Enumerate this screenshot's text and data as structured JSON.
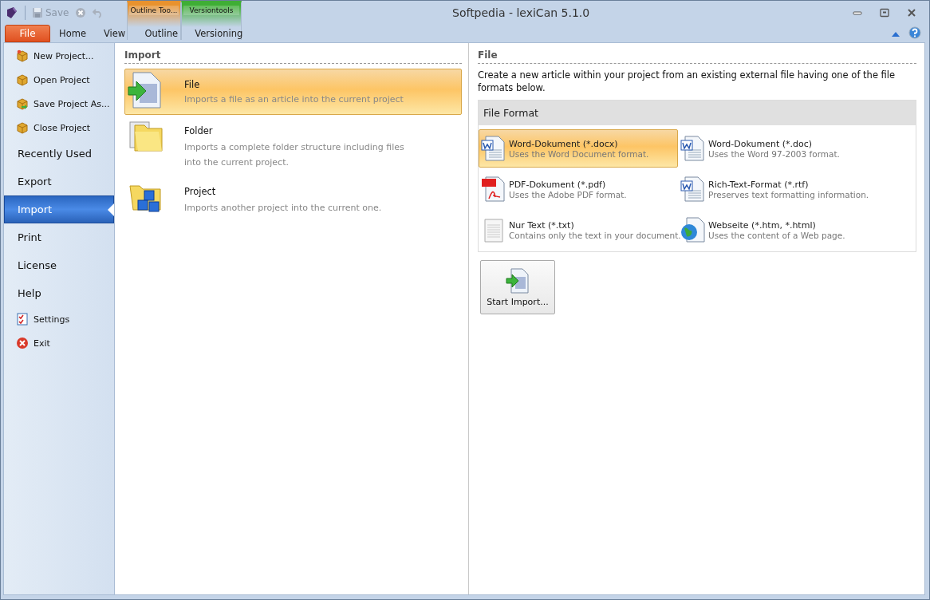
{
  "window": {
    "title": "Softpedia - lexiCan 5.1.0"
  },
  "quick_access": {
    "save_label": "Save"
  },
  "ribbon": {
    "file_button": "File",
    "tabs": [
      "Home",
      "View"
    ],
    "context_groups": [
      {
        "label": "Outline Too...",
        "color": "#e8922e",
        "tabs": [
          "Outline"
        ]
      },
      {
        "label": "Versiontools",
        "color": "#3fae35",
        "tabs": [
          "Versioning"
        ]
      }
    ]
  },
  "sidebar": {
    "items": [
      {
        "label": "New Project...",
        "kind": "command",
        "selected": false
      },
      {
        "label": "Open Project",
        "kind": "command",
        "selected": false
      },
      {
        "label": "Save Project As...",
        "kind": "command",
        "selected": false
      },
      {
        "label": "Close Project",
        "kind": "command",
        "selected": false
      },
      {
        "label": "Recently Used",
        "kind": "page",
        "selected": false
      },
      {
        "label": "Export",
        "kind": "page",
        "selected": false
      },
      {
        "label": "Import",
        "kind": "page",
        "selected": true
      },
      {
        "label": "Print",
        "kind": "page",
        "selected": false
      },
      {
        "label": "License",
        "kind": "page",
        "selected": false
      },
      {
        "label": "Help",
        "kind": "page",
        "selected": false
      },
      {
        "label": "Settings",
        "kind": "command",
        "selected": false
      },
      {
        "label": "Exit",
        "kind": "command",
        "selected": false
      }
    ]
  },
  "import_panel": {
    "heading": "Import",
    "options": [
      {
        "title": "File",
        "description": "Imports a file as an article into the current project",
        "selected": true
      },
      {
        "title": "Folder",
        "description": "Imports a complete folder structure including files into the current project.",
        "selected": false
      },
      {
        "title": "Project",
        "description": "Imports another project into the current one.",
        "selected": false
      }
    ]
  },
  "file_panel": {
    "heading": "File",
    "description": "Create a new article within your project from an existing external file having one of the file formats below.",
    "format_heading": "File Format",
    "formats": [
      {
        "title": "Word-Dokument (*.docx)",
        "description": "Uses the Word Document format.",
        "selected": true
      },
      {
        "title": "Word-Dokument (*.doc)",
        "description": "Uses the Word 97-2003 format.",
        "selected": false
      },
      {
        "title": "PDF-Dokument (*.pdf)",
        "description": "Uses the Adobe PDF format.",
        "selected": false
      },
      {
        "title": "Rich-Text-Format (*.rtf)",
        "description": "Preserves text formatting information.",
        "selected": false
      },
      {
        "title": "Nur Text (*.txt)",
        "description": "Contains only the text in your document.",
        "selected": false
      },
      {
        "title": "Webseite (*.htm, *.html)",
        "description": "Uses the content of a Web page.",
        "selected": false
      }
    ],
    "start_button": "Start Import..."
  }
}
